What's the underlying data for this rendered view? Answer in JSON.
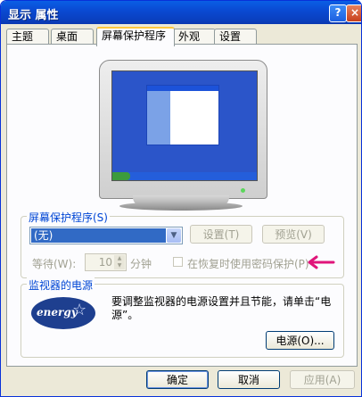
{
  "window": {
    "title": "显示 属性",
    "help_btn": "?",
    "close_btn": "×"
  },
  "tabs": [
    "主题",
    "桌面",
    "屏幕保护程序",
    "外观",
    "设置"
  ],
  "screensaver": {
    "group_label": "屏幕保护程序(S)",
    "selected": "(无)",
    "settings_btn": "设置(T)",
    "preview_btn": "预览(V)",
    "wait_label": "等待(W):",
    "wait_value": "10",
    "minutes_label": "分钟",
    "password_checkbox": "在恢复时使用密码保护(P)"
  },
  "power": {
    "group_label": "监视器的电源",
    "description": "要调整监视器的电源设置并且节能，请单击“电源”。",
    "power_btn": "电源(O)...",
    "logo_text": "energy"
  },
  "footer": {
    "ok": "确定",
    "cancel": "取消",
    "apply": "应用(A)"
  },
  "colors": {
    "title_bar": "#0a4ad3",
    "accent": "#0046d5",
    "arrow": "#e0157a"
  }
}
